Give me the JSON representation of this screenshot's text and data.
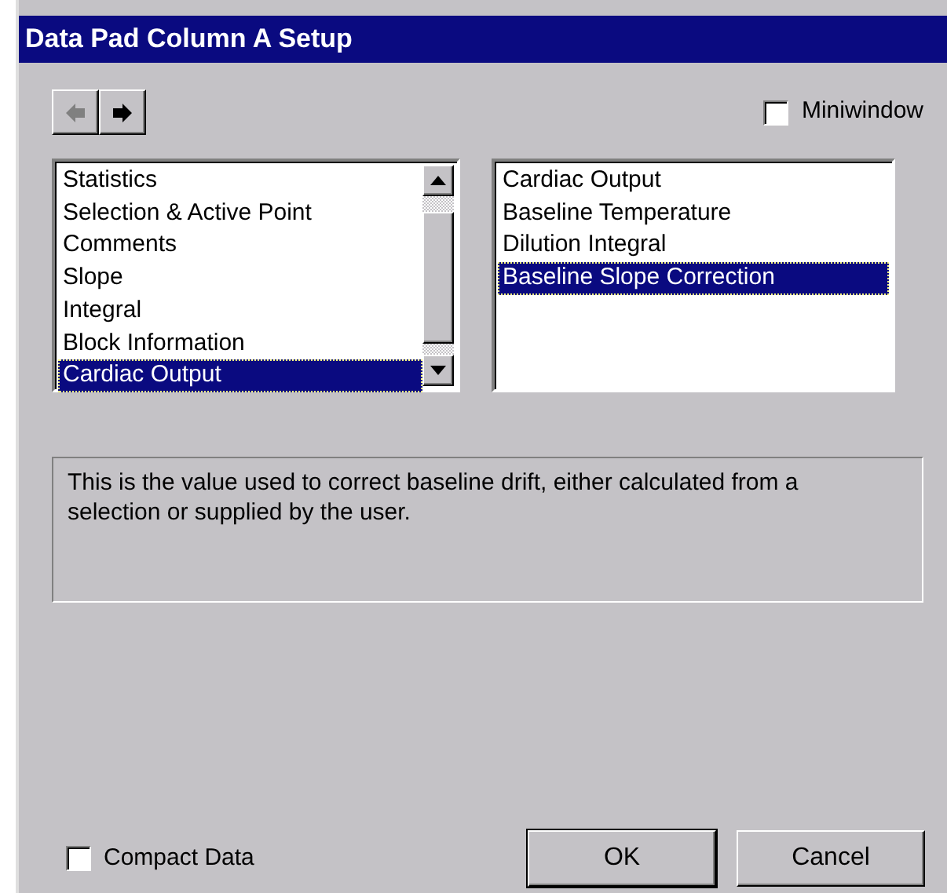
{
  "window": {
    "title": "Data Pad Column A Setup"
  },
  "nav_buttons": [
    {
      "kind": "back",
      "disabled": true
    },
    {
      "kind": "forward",
      "disabled": false
    }
  ],
  "miniwindow": {
    "label": "Miniwindow",
    "checked": false
  },
  "category_list": [
    {
      "label": "Statistics",
      "selected": false
    },
    {
      "label": "Selection & Active Point",
      "selected": false
    },
    {
      "label": "Comments",
      "selected": false
    },
    {
      "label": "Slope",
      "selected": false
    },
    {
      "label": "Integral",
      "selected": false
    },
    {
      "label": "Block Information",
      "selected": false
    },
    {
      "label": "Cardiac Output",
      "selected": true
    }
  ],
  "item_list": [
    {
      "label": "Cardiac Output",
      "selected": false
    },
    {
      "label": "Baseline Temperature",
      "selected": false
    },
    {
      "label": "Dilution Integral",
      "selected": false
    },
    {
      "label": "Baseline Slope Correction",
      "selected": true
    }
  ],
  "description": "This is the value used to correct baseline drift, either calculated from a selection or supplied by the user.",
  "compact_data": {
    "label": "Compact Data",
    "checked": false
  },
  "buttons": [
    {
      "label": "OK",
      "default": true
    },
    {
      "label": "Cancel",
      "default": false
    }
  ]
}
